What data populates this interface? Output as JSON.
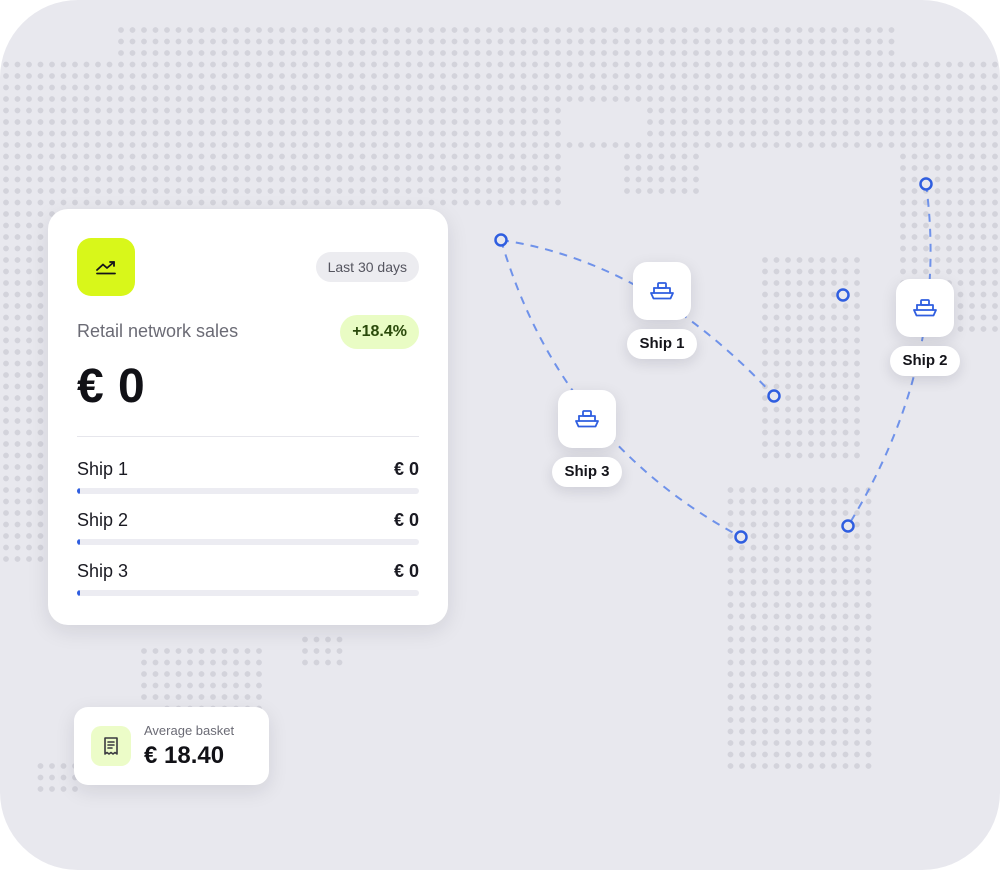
{
  "card": {
    "period": "Last 30 days",
    "title": "Retail network sales",
    "delta": "+18.4%",
    "total": "€ 0",
    "accent": "#d8f71a",
    "ships": [
      {
        "name": "Ship 1",
        "value": "€ 0",
        "progress": 0.01
      },
      {
        "name": "Ship 2",
        "value": "€ 0",
        "progress": 0.01
      },
      {
        "name": "Ship 3",
        "value": "€ 0",
        "progress": 0.01
      }
    ]
  },
  "basket": {
    "label": "Average basket",
    "value": "€ 18.40"
  },
  "map": {
    "route_color": "#2f5ee0",
    "markers": [
      {
        "label": "Ship 1",
        "icon": "ship-icon"
      },
      {
        "label": "Ship 2",
        "icon": "ship-icon"
      },
      {
        "label": "Ship 3",
        "icon": "ship-icon"
      }
    ]
  },
  "icons": {
    "trend": "trending-up-icon",
    "receipt": "receipt-icon"
  }
}
